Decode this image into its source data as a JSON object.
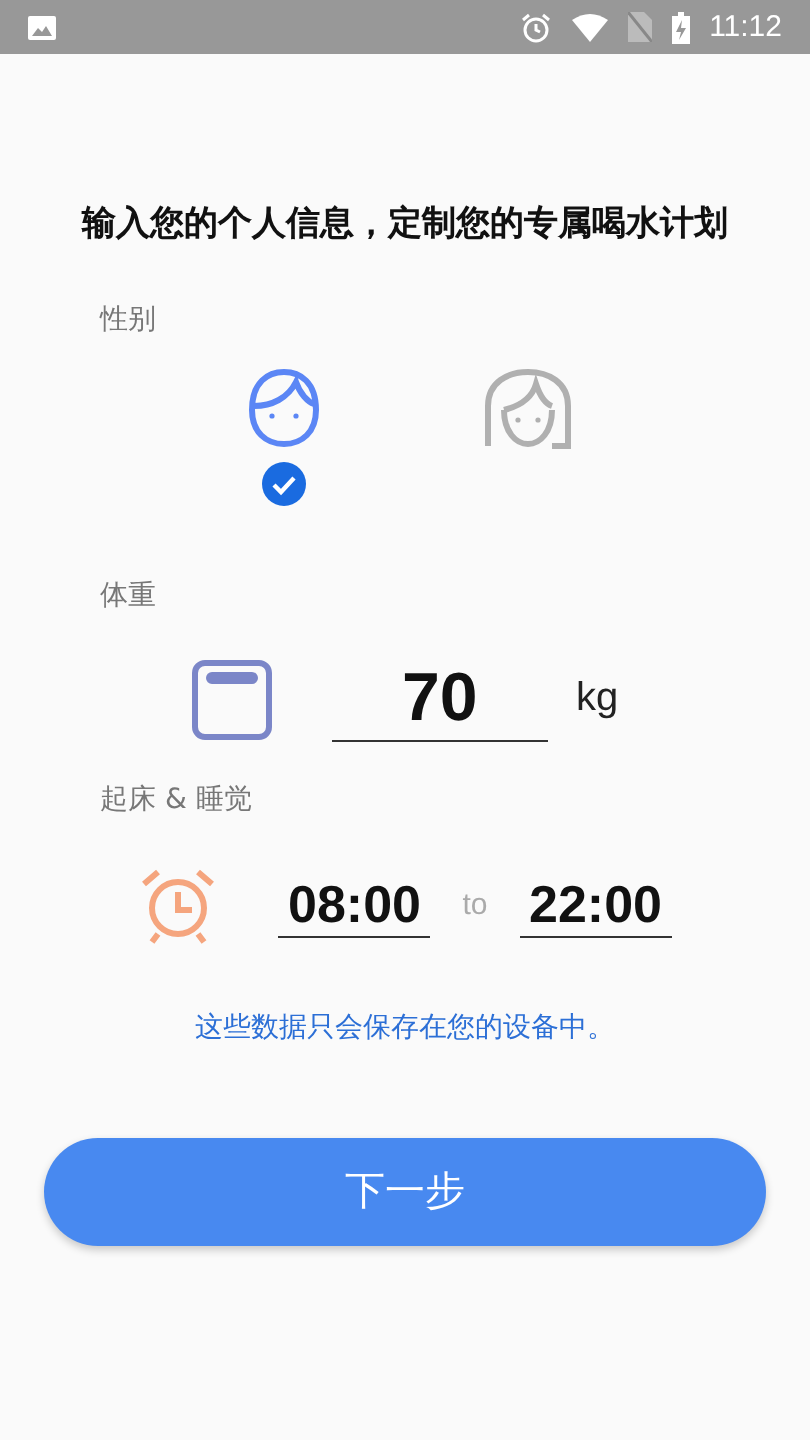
{
  "status_bar": {
    "time": "11:12"
  },
  "title": "输入您的个人信息，定制您的专属喝水计划",
  "gender": {
    "label": "性别",
    "options": [
      {
        "kind": "male",
        "selected": true
      },
      {
        "kind": "female",
        "selected": false
      }
    ]
  },
  "weight": {
    "label": "体重",
    "value": "70",
    "unit": "kg"
  },
  "schedule": {
    "label": "起床 & 睡觉",
    "wake": "08:00",
    "separator": "to",
    "sleep": "22:00"
  },
  "note": "这些数据只会保存在您的设备中。",
  "button": "下一步"
}
